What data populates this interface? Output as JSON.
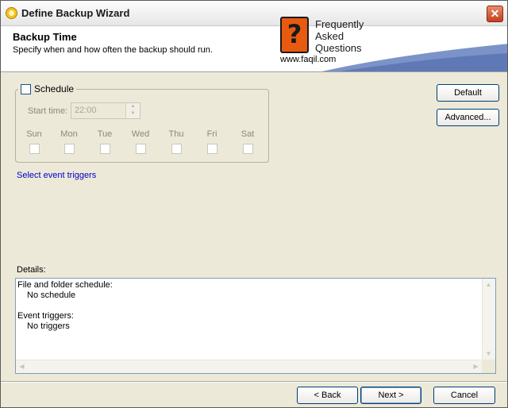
{
  "window": {
    "title": "Define Backup Wizard"
  },
  "header": {
    "title": "Backup Time",
    "subtitle": "Specify when and how often the backup should run.",
    "logo_text": [
      "Frequently",
      "Asked",
      "Questions"
    ],
    "logo_url": "www.faqil.com"
  },
  "schedule": {
    "checkbox_label": "Schedule",
    "checked": false,
    "start_time_label": "Start time:",
    "start_time_value": "22:00",
    "days": [
      "Sun",
      "Mon",
      "Tue",
      "Wed",
      "Thu",
      "Fri",
      "Sat"
    ]
  },
  "buttons": {
    "default": "Default",
    "advanced": "Advanced...",
    "back": "< Back",
    "next": "Next >",
    "cancel": "Cancel"
  },
  "event_link": "Select event triggers",
  "details": {
    "label": "Details:",
    "file_schedule_heading": "File and folder schedule:",
    "file_schedule_value": "No schedule",
    "event_triggers_heading": "Event triggers:",
    "event_triggers_value": "No triggers"
  },
  "colors": {
    "accent": "#003c74",
    "link": "#0000cc",
    "header_band": "#7c93c9"
  }
}
